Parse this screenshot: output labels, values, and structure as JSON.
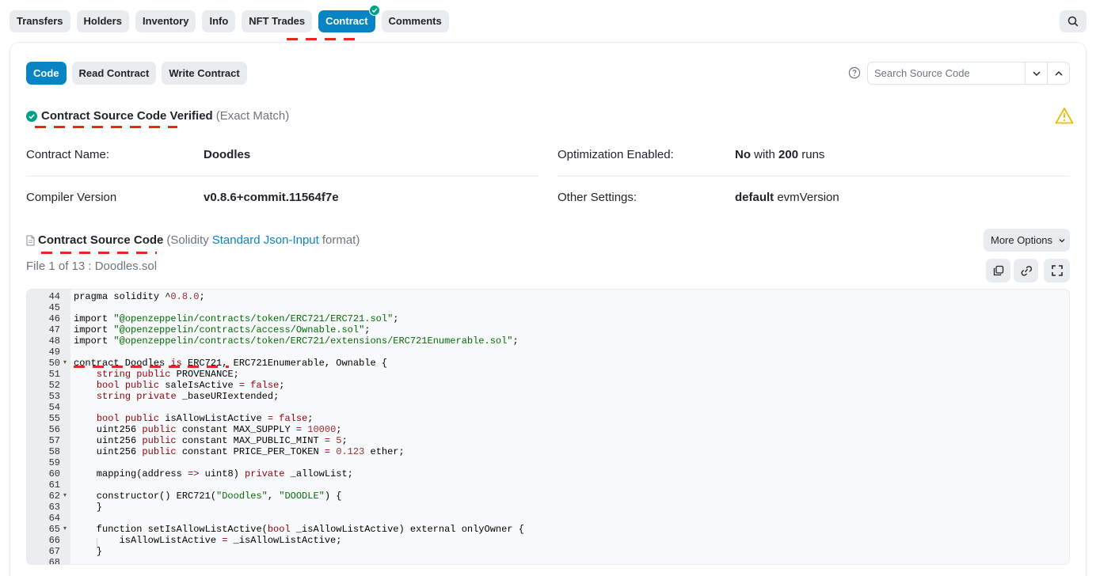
{
  "top_tabs": [
    "Transfers",
    "Holders",
    "Inventory",
    "Info",
    "NFT Trades",
    "Contract",
    "Comments"
  ],
  "active_top_tab": "Contract",
  "sub_tabs": [
    "Code",
    "Read Contract",
    "Write Contract"
  ],
  "search": {
    "placeholder": "Search Source Code"
  },
  "verified": {
    "title": "Contract Source Code Verified",
    "match": "(Exact Match)"
  },
  "info": {
    "contract_name_label": "Contract Name:",
    "contract_name_value": "Doodles",
    "compiler_label": "Compiler Version",
    "compiler_value": "v0.8.6+commit.11564f7e",
    "optimization_label": "Optimization Enabled:",
    "optimization_value": "No",
    "optimization_with": "with",
    "optimization_runs": "200",
    "optimization_runs_suffix": "runs",
    "other_label": "Other Settings:",
    "other_value": "default",
    "other_suffix": "evmVersion"
  },
  "source": {
    "title": "Contract Source Code",
    "paren_open": "(Solidity",
    "link": "Standard Json-Input",
    "paren_close": "format)",
    "more_options": "More Options",
    "file_label": "File 1 of 13 : Doodles.sol"
  },
  "code_lines": [
    {
      "n": "44",
      "fold": false,
      "t": "pragma solidity ^0.8.0;"
    },
    {
      "n": "45",
      "fold": false,
      "t": ""
    },
    {
      "n": "46",
      "fold": false,
      "t": "import \"@openzeppelin/contracts/token/ERC721/ERC721.sol\";"
    },
    {
      "n": "47",
      "fold": false,
      "t": "import \"@openzeppelin/contracts/access/Ownable.sol\";"
    },
    {
      "n": "48",
      "fold": false,
      "t": "import \"@openzeppelin/contracts/token/ERC721/extensions/ERC721Enumerable.sol\";"
    },
    {
      "n": "49",
      "fold": false,
      "t": ""
    },
    {
      "n": "50",
      "fold": true,
      "t": "contract Doodles is ERC721, ERC721Enumerable, Ownable {"
    },
    {
      "n": "51",
      "fold": false,
      "t": "    string public PROVENANCE;"
    },
    {
      "n": "52",
      "fold": false,
      "t": "    bool public saleIsActive = false;"
    },
    {
      "n": "53",
      "fold": false,
      "t": "    string private _baseURIextended;"
    },
    {
      "n": "54",
      "fold": false,
      "t": ""
    },
    {
      "n": "55",
      "fold": false,
      "t": "    bool public isAllowListActive = false;"
    },
    {
      "n": "56",
      "fold": false,
      "t": "    uint256 public constant MAX_SUPPLY = 10000;"
    },
    {
      "n": "57",
      "fold": false,
      "t": "    uint256 public constant MAX_PUBLIC_MINT = 5;"
    },
    {
      "n": "58",
      "fold": false,
      "t": "    uint256 public constant PRICE_PER_TOKEN = 0.123 ether;"
    },
    {
      "n": "59",
      "fold": false,
      "t": ""
    },
    {
      "n": "60",
      "fold": false,
      "t": "    mapping(address => uint8) private _allowList;"
    },
    {
      "n": "61",
      "fold": false,
      "t": ""
    },
    {
      "n": "62",
      "fold": true,
      "t": "    constructor() ERC721(\"Doodles\", \"DOODLE\") {"
    },
    {
      "n": "63",
      "fold": false,
      "t": "    }"
    },
    {
      "n": "64",
      "fold": false,
      "t": ""
    },
    {
      "n": "65",
      "fold": true,
      "t": "    function setIsAllowListActive(bool _isAllowListActive) external onlyOwner {"
    },
    {
      "n": "66",
      "fold": false,
      "t": "        isAllowListActive = _isAllowListActive;"
    },
    {
      "n": "67",
      "fold": false,
      "t": "    }"
    },
    {
      "n": "68",
      "fold": false,
      "t": ""
    }
  ],
  "colors": {
    "accent": "#0784c3",
    "verified": "#00a186",
    "warning": "#f0b90b",
    "annotation": "#e8271d",
    "string": "#036a07",
    "keyword": "#93000a",
    "number": "#a12c2c"
  }
}
